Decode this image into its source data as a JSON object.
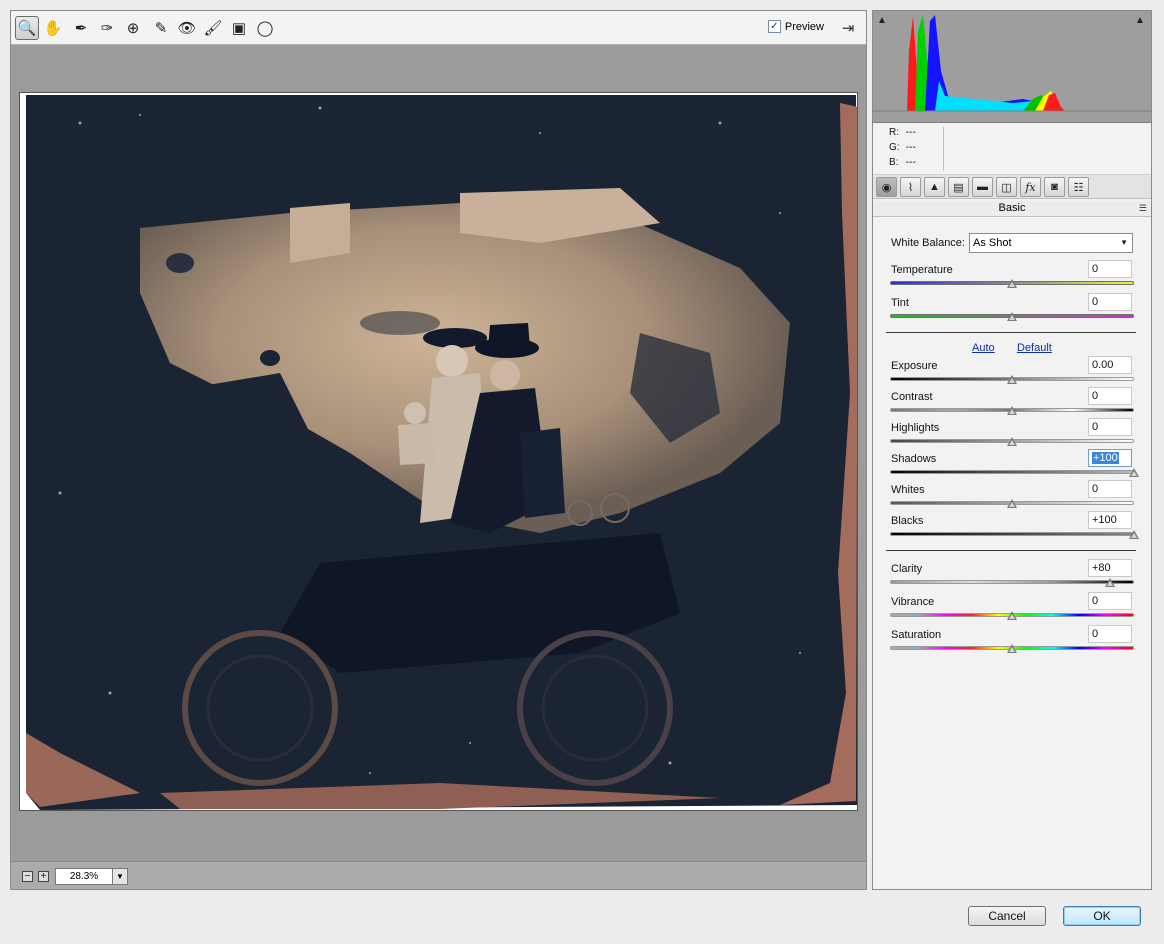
{
  "toolbar": {
    "tools": [
      {
        "icon": "zoom-tool-icon",
        "glyph": "🔍",
        "active": true
      },
      {
        "icon": "hand-tool-icon",
        "glyph": "✋"
      },
      {
        "icon": "white-balance-tool-icon",
        "glyph": "✒"
      },
      {
        "icon": "color-sampler-tool-icon",
        "glyph": "✑"
      },
      {
        "icon": "targeted-adjustment-tool-icon",
        "glyph": "⊕"
      },
      {
        "icon": "spot-removal-tool-icon",
        "glyph": "✎"
      },
      {
        "icon": "red-eye-removal-tool-icon",
        "glyph": "👁"
      },
      {
        "icon": "adjustment-brush-tool-icon",
        "glyph": "🖌"
      },
      {
        "icon": "graduated-filter-tool-icon",
        "glyph": "▣"
      },
      {
        "icon": "radial-filter-tool-icon",
        "glyph": "◯"
      }
    ],
    "preview_label": "Preview",
    "preview_checked": "✓"
  },
  "zoom": {
    "minus": "−",
    "plus": "+",
    "value": "28.3%",
    "dropdown_glyph": "▼"
  },
  "info": {
    "r_label": "R:",
    "r_value": "---",
    "g_label": "G:",
    "g_value": "---",
    "b_label": "B:",
    "b_value": "---"
  },
  "panel": {
    "section_title": "Basic",
    "menu_glyph": "☰",
    "tabs": [
      {
        "icon": "basic-tab-icon",
        "glyph": "◉"
      },
      {
        "icon": "tone-curve-tab-icon",
        "glyph": "⌇"
      },
      {
        "icon": "detail-tab-icon",
        "glyph": "▲"
      },
      {
        "icon": "hsl-tab-icon",
        "glyph": "▤"
      },
      {
        "icon": "split-toning-tab-icon",
        "glyph": "▬"
      },
      {
        "icon": "lens-corrections-tab-icon",
        "glyph": "◫"
      },
      {
        "icon": "effects-tab-icon",
        "glyph": "fx"
      },
      {
        "icon": "camera-calibration-tab-icon",
        "glyph": "◙"
      },
      {
        "icon": "presets-tab-icon",
        "glyph": "☷"
      }
    ],
    "white_balance_label": "White Balance:",
    "white_balance_value": "As Shot",
    "auto_link": "Auto",
    "default_link": "Default",
    "sliders": {
      "temperature": {
        "label": "Temperature",
        "value": "0",
        "level": 0.5
      },
      "tint": {
        "label": "Tint",
        "value": "0",
        "level": 0.5
      },
      "exposure": {
        "label": "Exposure",
        "value": "0.00",
        "level": 0.5
      },
      "contrast": {
        "label": "Contrast",
        "value": "0",
        "level": 0.5
      },
      "highlights": {
        "label": "Highlights",
        "value": "0",
        "level": 0.5
      },
      "shadows": {
        "label": "Shadows",
        "value": "+100",
        "level": 1.0,
        "selected": true
      },
      "whites": {
        "label": "Whites",
        "value": "0",
        "level": 0.5
      },
      "blacks": {
        "label": "Blacks",
        "value": "+100",
        "level": 1.0
      },
      "clarity": {
        "label": "Clarity",
        "value": "+80",
        "level": 0.9
      },
      "vibrance": {
        "label": "Vibrance",
        "value": "0",
        "level": 0.5
      },
      "saturation": {
        "label": "Saturation",
        "value": "0",
        "level": 0.5
      }
    }
  },
  "buttons": {
    "cancel": "Cancel",
    "ok": "OK"
  },
  "colors": {
    "accent": "#3b86d9",
    "photo_dark": "#1b2433",
    "photo_sepia": "#c3a88c",
    "photo_border": "#b07a68"
  }
}
